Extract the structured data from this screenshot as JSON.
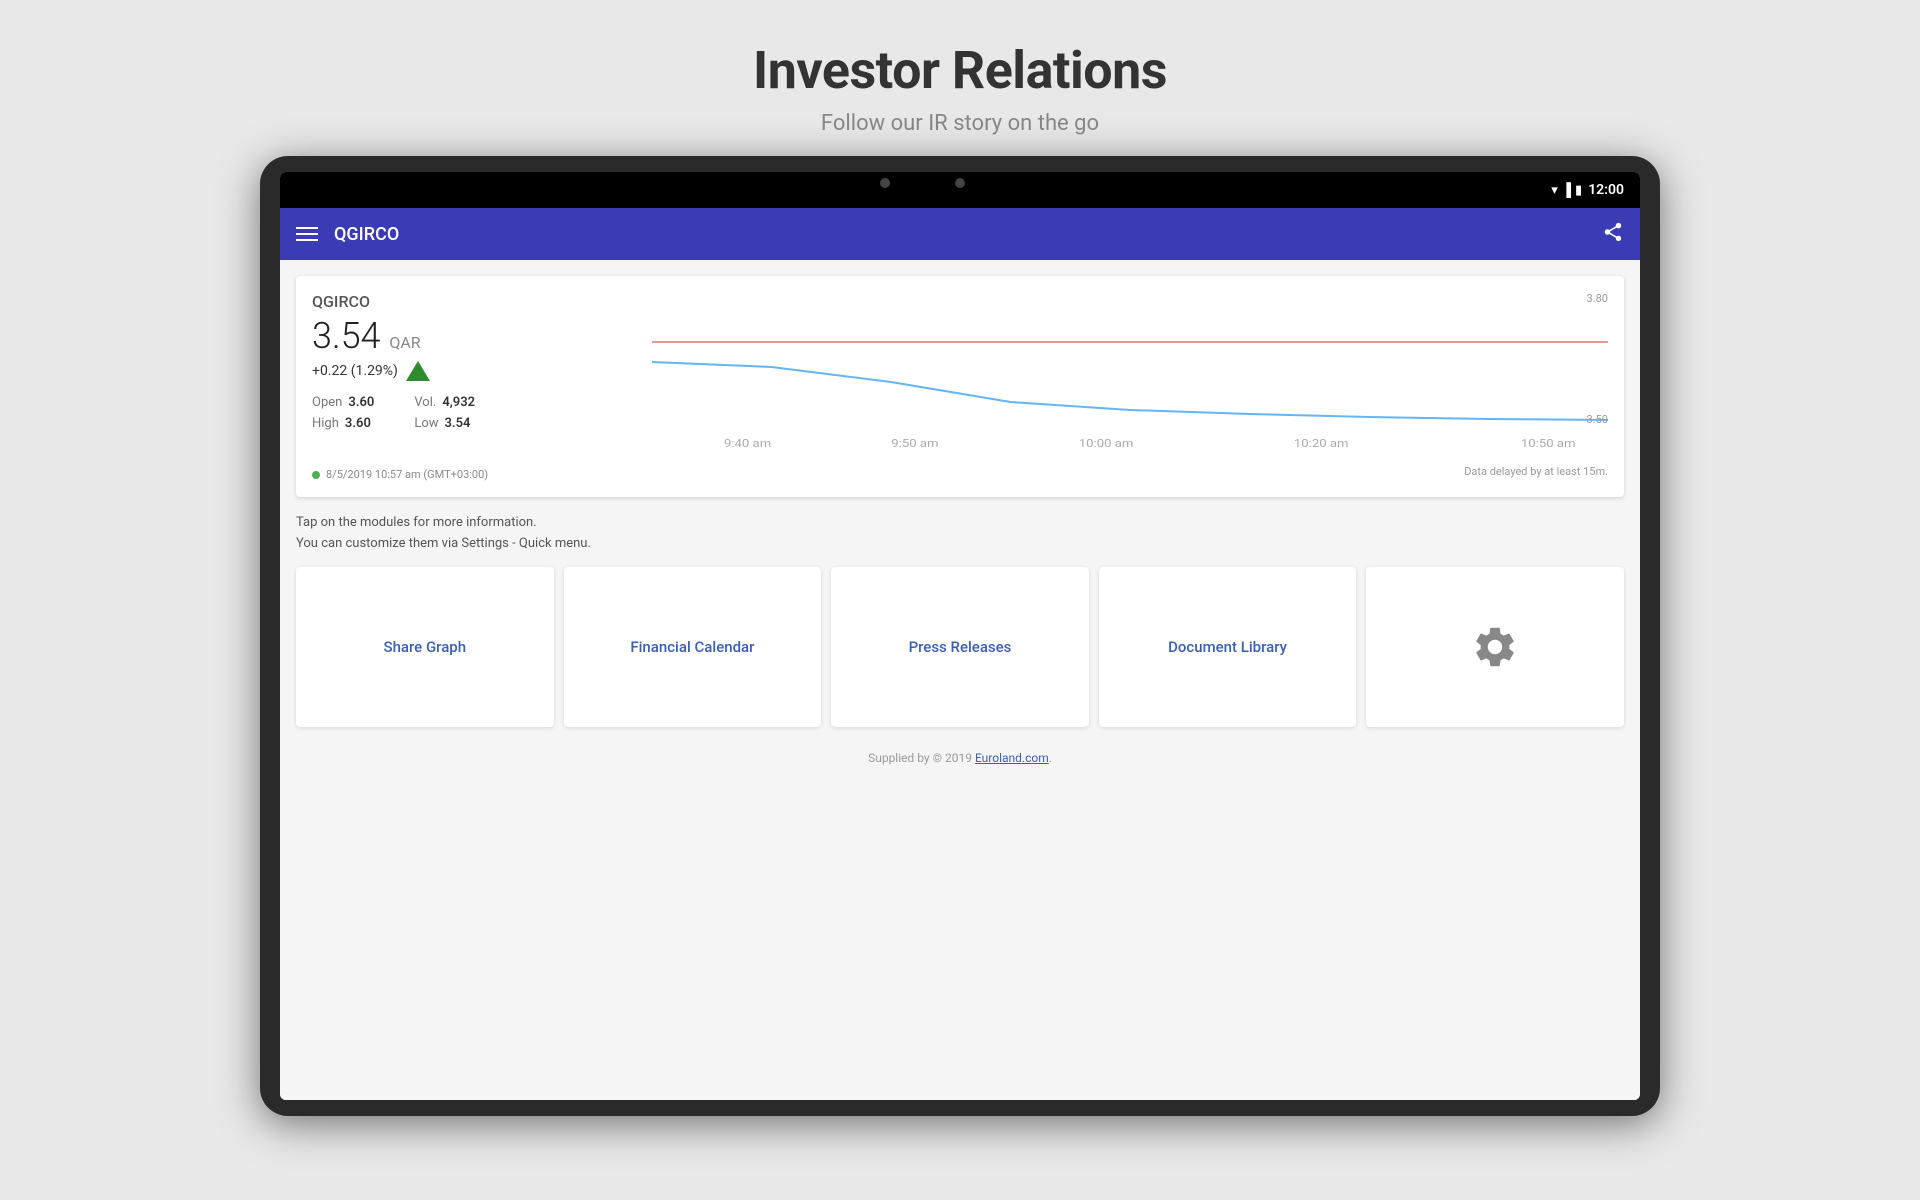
{
  "page": {
    "title": "Investor Relations",
    "subtitle": "Follow our IR story on the go"
  },
  "status_bar": {
    "time": "12:00"
  },
  "app_bar": {
    "title": "QGIRCO",
    "menu_icon": "≡",
    "share_icon": "⤴"
  },
  "stock": {
    "ticker": "QGIRCO",
    "price": "3.54",
    "currency": "QAR",
    "change": "+0.22 (1.29%)",
    "open_label": "Open",
    "open_value": "3.60",
    "high_label": "High",
    "high_value": "3.60",
    "vol_label": "Vol.",
    "vol_value": "4,932",
    "low_label": "Low",
    "low_value": "3.54",
    "timestamp": "8/5/2019 10:57 am (GMT+03:00)",
    "y_max": "3.80",
    "y_min": "3.50",
    "data_delay": "Data delayed by at least 15m.",
    "x_labels": [
      "9:40 am",
      "9:50 am",
      "10:00 am",
      "10:20 am",
      "10:50 am"
    ]
  },
  "instructions": {
    "line1": "Tap on the modules for more information.",
    "line2": "You can customize them via Settings - Quick menu."
  },
  "modules": [
    {
      "id": "share-graph",
      "label": "Share Graph",
      "type": "text"
    },
    {
      "id": "financial-calendar",
      "label": "Financial Calendar",
      "type": "text"
    },
    {
      "id": "press-releases",
      "label": "Press Releases",
      "type": "text"
    },
    {
      "id": "document-library",
      "label": "Document Library",
      "type": "text"
    },
    {
      "id": "settings",
      "label": "",
      "type": "icon"
    }
  ],
  "footer": {
    "text": "Supplied by © 2019 ",
    "link_text": "Euroland.com",
    "period": "."
  }
}
